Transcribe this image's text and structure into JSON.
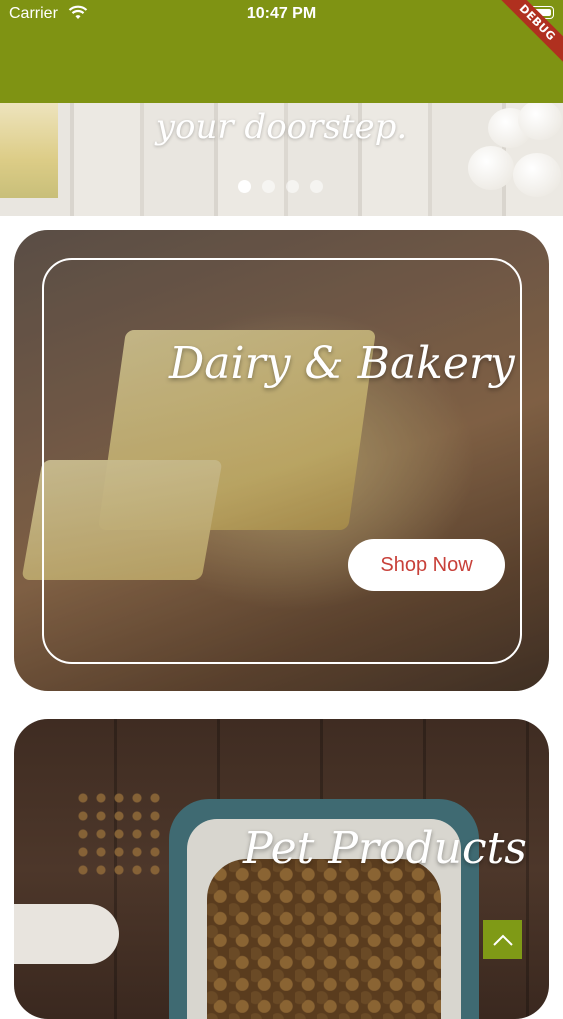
{
  "status_bar": {
    "carrier": "Carrier",
    "time": "10:47 PM"
  },
  "debug_banner": "DEBUG",
  "carousel": {
    "tagline": "your doorstep.",
    "dots": 4,
    "active_dot": 0
  },
  "categories": [
    {
      "title": "Dairy & Bakery",
      "button": "Shop Now"
    },
    {
      "title": "Pet Products"
    }
  ],
  "colors": {
    "app_bar": "#7f9313",
    "button_text": "#c8413a",
    "scroll_top_button": "#7f9a16"
  },
  "icons": {
    "scroll_top": "chevron-up-icon",
    "wifi": "wifi-icon",
    "battery": "battery-icon"
  }
}
